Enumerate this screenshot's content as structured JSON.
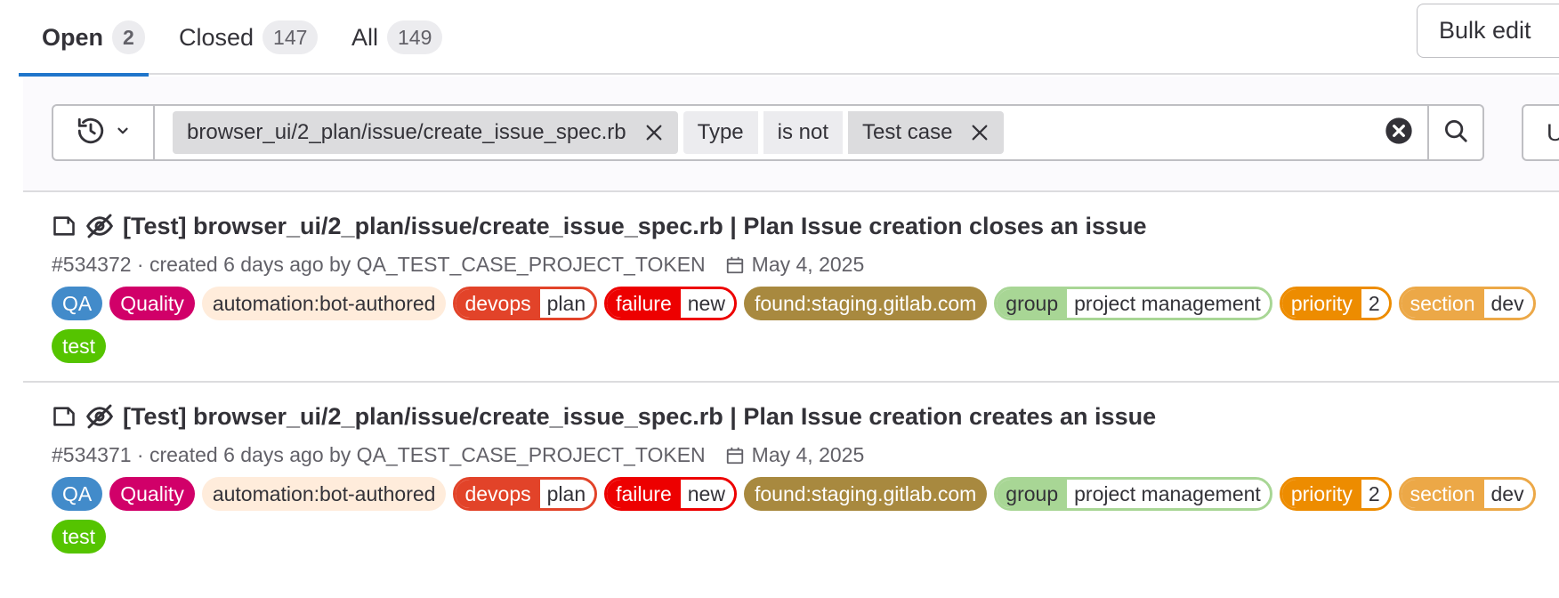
{
  "tabs": [
    {
      "label": "Open",
      "count": "2"
    },
    {
      "label": "Closed",
      "count": "147"
    },
    {
      "label": "All",
      "count": "149"
    }
  ],
  "bulk_edit_label": "Bulk edit",
  "filter": {
    "tokens": [
      {
        "text": "browser_ui/2_plan/issue/create_issue_spec.rb"
      },
      {
        "text": "Type"
      },
      {
        "text": "is not"
      },
      {
        "text": "Test case"
      }
    ],
    "sort_label": "Upd"
  },
  "colors": {
    "accent": "#1f75cb",
    "qa": "#428bca",
    "quality": "#d10069",
    "automation": "#ffecdb",
    "devops": "#e24329",
    "failure": "#ed0000",
    "found": "#a8893f",
    "group": "#a8d695",
    "priority": "#ed8c00",
    "section": "#eca847",
    "test": "#55c400"
  },
  "issues": [
    {
      "title": "[Test] browser_ui/2_plan/issue/create_issue_spec.rb | Plan Issue creation closes an issue",
      "meta": "#534372 · created 6 days ago by QA_TEST_CASE_PROJECT_TOKEN",
      "due": "May 4, 2025",
      "labels": [
        {
          "text": "QA"
        },
        {
          "text": "Quality"
        },
        {
          "text": "automation:bot-authored"
        },
        {
          "key": "devops",
          "value": "plan"
        },
        {
          "key": "failure",
          "value": "new"
        },
        {
          "text": "found:staging.gitlab.com"
        },
        {
          "key": "group",
          "value": "project management"
        },
        {
          "key": "priority",
          "value": "2"
        },
        {
          "key": "section",
          "value": "dev"
        },
        {
          "text": "test"
        }
      ]
    },
    {
      "title": "[Test] browser_ui/2_plan/issue/create_issue_spec.rb | Plan Issue creation creates an issue",
      "meta": "#534371 · created 6 days ago by QA_TEST_CASE_PROJECT_TOKEN",
      "due": "May 4, 2025",
      "labels": [
        {
          "text": "QA"
        },
        {
          "text": "Quality"
        },
        {
          "text": "automation:bot-authored"
        },
        {
          "key": "devops",
          "value": "plan"
        },
        {
          "key": "failure",
          "value": "new"
        },
        {
          "text": "found:staging.gitlab.com"
        },
        {
          "key": "group",
          "value": "project management"
        },
        {
          "key": "priority",
          "value": "2"
        },
        {
          "key": "section",
          "value": "dev"
        },
        {
          "text": "test"
        }
      ]
    }
  ]
}
